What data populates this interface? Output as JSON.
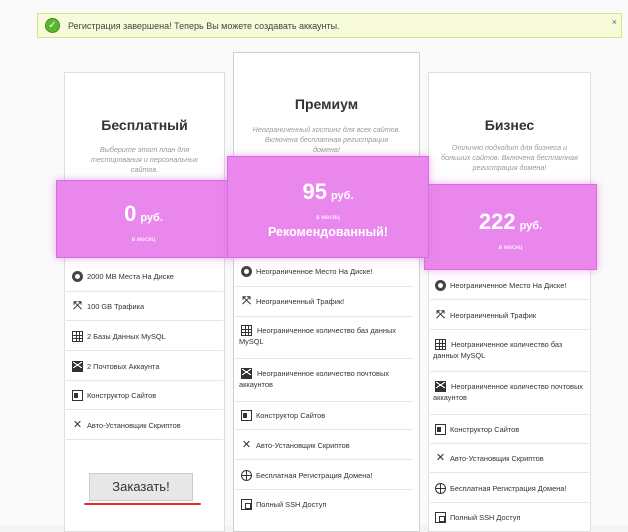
{
  "notice": {
    "message": "Регистрация завершена! Теперь Вы можете создавать аккаунты.",
    "close_label": "×",
    "icon": "check-circle-icon"
  },
  "plans": {
    "free": {
      "name": "Бесплатный",
      "description": "Выберите этот план для тестирования и персональных сайтов.",
      "price_amount": "0",
      "price_currency": "руб.",
      "price_period": "в месяц",
      "features": [
        {
          "icon": "disk-icon",
          "text": "2000 MB Места На Диске"
        },
        {
          "icon": "arrows-expand-icon",
          "text": "100 GB Трафика"
        },
        {
          "icon": "database-grid-icon",
          "text": "2 Базы Данных MySQL"
        },
        {
          "icon": "mail-icon",
          "text": "2 Почтовых Аккаунта"
        },
        {
          "icon": "site-builder-icon",
          "text": "Конструктор Сайтов"
        },
        {
          "icon": "tools-icon",
          "text": "Авто-Установщик Скриптов"
        }
      ],
      "order_label": "Заказать!"
    },
    "premium": {
      "name": "Премиум",
      "description": "Неограниченный хостинг для всех сайтов. Включена бесплатная регистрация домена!",
      "price_amount": "95",
      "price_currency": "руб.",
      "price_period": "в месяц",
      "badge": "Рекомендованный!",
      "features": [
        {
          "icon": "disk-icon",
          "text": "Неограниченное Место На Диске!"
        },
        {
          "icon": "arrows-expand-icon",
          "text": "Неограниченный Трафик!"
        },
        {
          "icon": "database-grid-icon",
          "text": "Неограниченное количество баз данных MySQL"
        },
        {
          "icon": "mail-icon",
          "text": "Неограниченное количество почтовых аккаунтов"
        },
        {
          "icon": "site-builder-icon",
          "text": "Конструктор Сайтов"
        },
        {
          "icon": "tools-icon",
          "text": "Авто-Установщик Скриптов"
        },
        {
          "icon": "globe-icon",
          "text": "Бесплатная Регистрация Домена!"
        },
        {
          "icon": "ssh-icon",
          "text": "Полный SSH Доступ"
        }
      ]
    },
    "business": {
      "name": "Бизнес",
      "description": "Отлично подходит для бизнеса и больших сайтов. Включена бесплатная регистрация домена!",
      "price_amount": "222",
      "price_currency": "руб.",
      "price_period": "в месяц",
      "features": [
        {
          "icon": "disk-icon",
          "text": "Неограниченное Место На Диске!"
        },
        {
          "icon": "arrows-expand-icon",
          "text": "Неограниченный Трафик"
        },
        {
          "icon": "database-grid-icon",
          "text": "Неограниченное количество баз данных MySQL"
        },
        {
          "icon": "mail-icon",
          "text": "Неограниченное количество почтовых аккаунтов"
        },
        {
          "icon": "site-builder-icon",
          "text": "Конструктор Сайтов"
        },
        {
          "icon": "tools-icon",
          "text": "Авто-Установщик Скриптов"
        },
        {
          "icon": "globe-icon",
          "text": "Бесплатная Регистрация Домена!"
        },
        {
          "icon": "ssh-icon",
          "text": "Полный SSH Доступ"
        }
      ]
    }
  },
  "colors": {
    "price_box": "#e987ec",
    "notice_bg": "#f7fbd9",
    "success": "#5cb531",
    "underline": "#e52b2b"
  }
}
